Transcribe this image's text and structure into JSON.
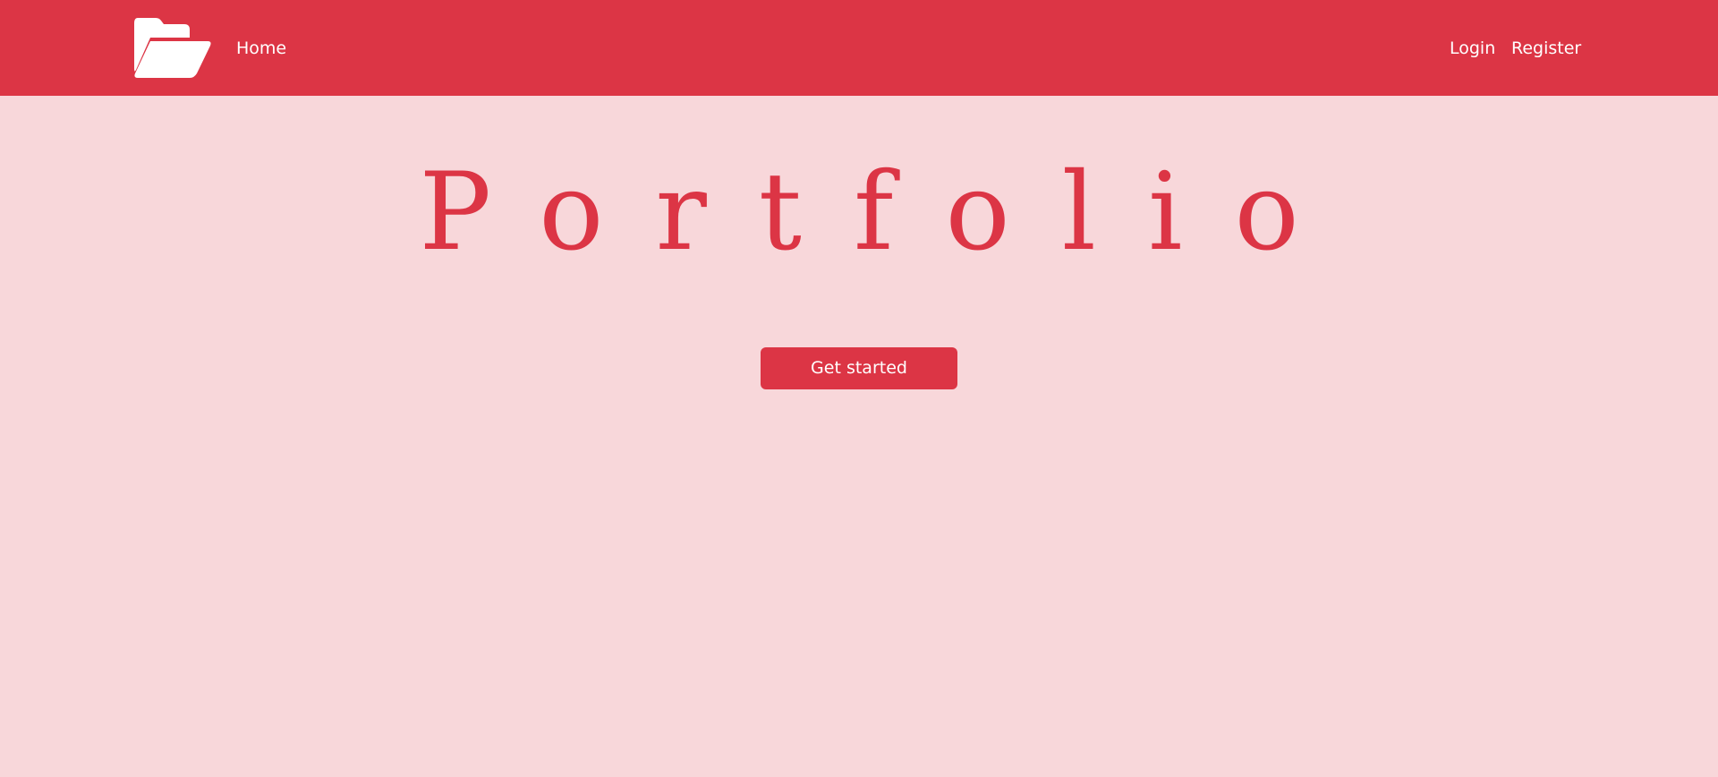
{
  "navbar": {
    "brand_icon": "folder-open-icon",
    "color": "#dc3545",
    "links": {
      "home": "Home",
      "login": "Login",
      "register": "Register"
    }
  },
  "hero": {
    "title": "Portfolio",
    "button_label": "Get started",
    "background": "#f8d7da",
    "accent": "#dc3545"
  }
}
